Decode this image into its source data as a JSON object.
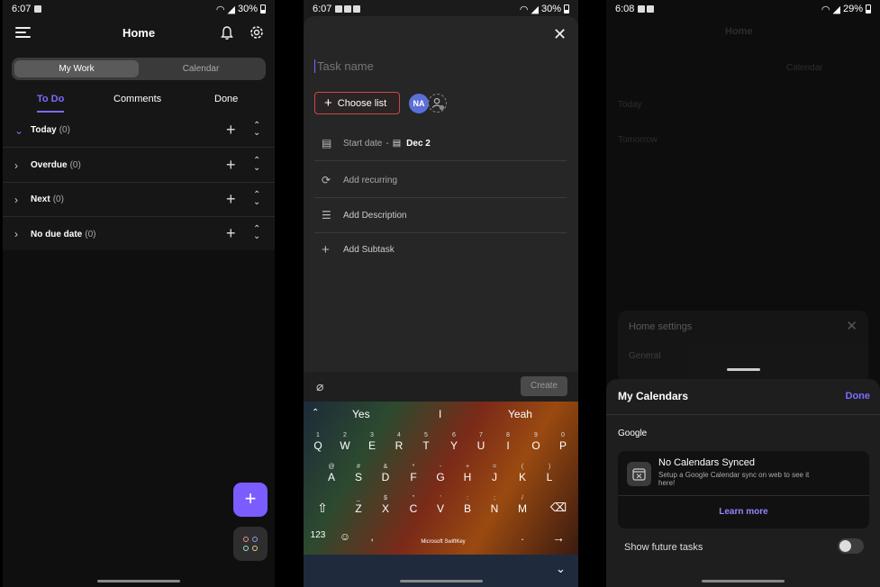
{
  "panel1": {
    "status": {
      "time": "6:07",
      "battery": "30%"
    },
    "title": "Home",
    "segments": [
      "My Work",
      "Calendar"
    ],
    "tabs": [
      "To Do",
      "Comments",
      "Done"
    ],
    "sections": [
      {
        "label": "Today",
        "count": "(0)",
        "expanded": true
      },
      {
        "label": "Overdue",
        "count": "(0)",
        "expanded": false
      },
      {
        "label": "Next",
        "count": "(0)",
        "expanded": false
      },
      {
        "label": "No due date",
        "count": "(0)",
        "expanded": false
      }
    ],
    "fab": "+"
  },
  "panel2": {
    "status": {
      "time": "6:07",
      "battery": "30%"
    },
    "task_placeholder": "Task name",
    "choose_list": "Choose list",
    "avatar": "NA",
    "start_date_label": "Start date",
    "start_date_sep": "-",
    "start_date_value": "Dec 2",
    "add_recurring": "Add recurring",
    "add_description": "Add Description",
    "add_subtask": "Add Subtask",
    "create": "Create",
    "keyboard": {
      "suggestions": [
        "Yes",
        "I",
        "Yeah"
      ],
      "row1": [
        [
          "Q",
          "1"
        ],
        [
          "W",
          "2"
        ],
        [
          "E",
          "3"
        ],
        [
          "R",
          "4"
        ],
        [
          "T",
          "5"
        ],
        [
          "Y",
          "6"
        ],
        [
          "U",
          "7"
        ],
        [
          "I",
          "8"
        ],
        [
          "O",
          "9"
        ],
        [
          "P",
          "0"
        ]
      ],
      "row2": [
        [
          "A",
          "@"
        ],
        [
          "S",
          "#"
        ],
        [
          "D",
          "&"
        ],
        [
          "F",
          "*"
        ],
        [
          "G",
          "-"
        ],
        [
          "H",
          "+"
        ],
        [
          "J",
          "="
        ],
        [
          "K",
          "("
        ],
        [
          "L",
          ")"
        ]
      ],
      "row3": [
        [
          "Z",
          "_"
        ],
        [
          "X",
          "$"
        ],
        [
          "C",
          "\""
        ],
        [
          "V",
          "'"
        ],
        [
          "B",
          ":"
        ],
        [
          "N",
          ";"
        ],
        [
          "M",
          "/"
        ]
      ],
      "num_key": "123",
      "space_brand": "Microsoft SwiftKey",
      "period": "."
    }
  },
  "panel3": {
    "status": {
      "time": "6:08",
      "battery": "29%"
    },
    "bg_title": "Home",
    "bg_tab": "Calendar",
    "bg_sections": [
      "Today",
      "Tomorrow"
    ],
    "settings_title": "Home settings",
    "settings_general": "General",
    "sheet_title": "My Calendars",
    "done": "Done",
    "provider": "Google",
    "no_sync_title": "No Calendars Synced",
    "no_sync_desc": "Setup a Google Calendar sync on web to see it here!",
    "learn_more": "Learn more",
    "show_future": "Show future tasks",
    "show_future_on": false
  },
  "colors": {
    "accent": "#7b6cff",
    "fab": "#7b5cff",
    "danger": "#c94a4a"
  }
}
